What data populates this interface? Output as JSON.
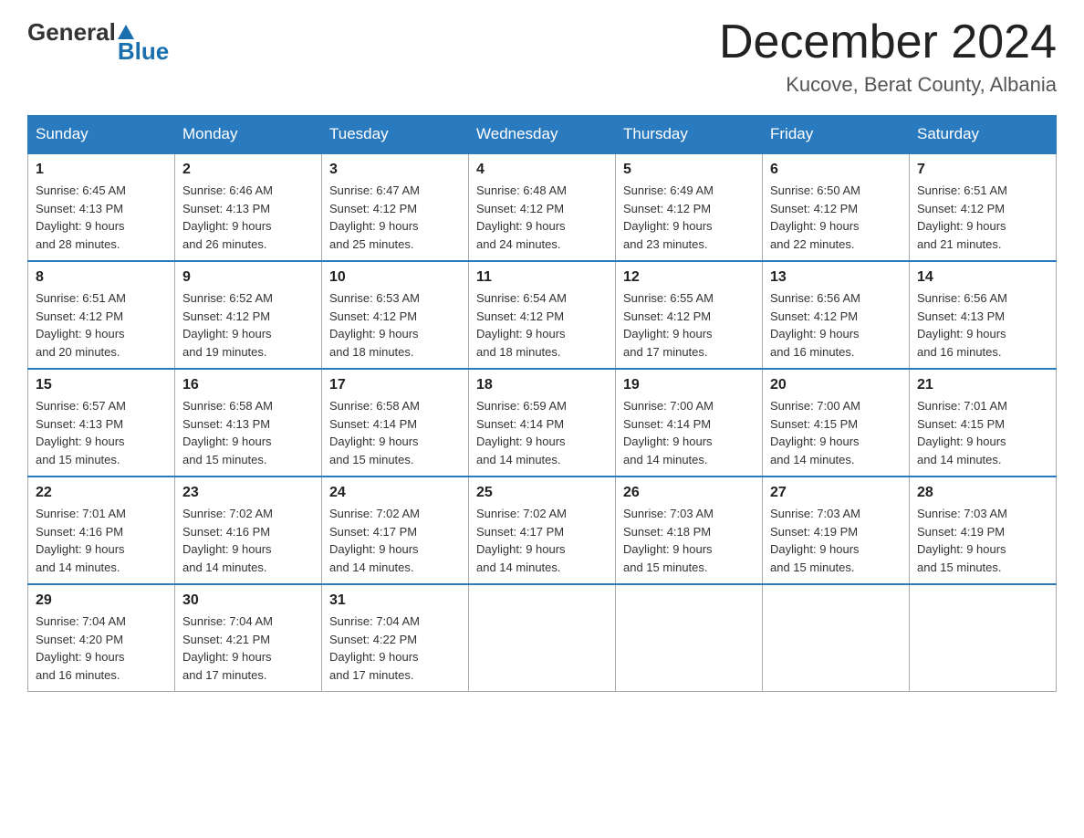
{
  "logo": {
    "general": "General",
    "blue": "Blue"
  },
  "header": {
    "month": "December 2024",
    "location": "Kucove, Berat County, Albania"
  },
  "days_of_week": [
    "Sunday",
    "Monday",
    "Tuesday",
    "Wednesday",
    "Thursday",
    "Friday",
    "Saturday"
  ],
  "weeks": [
    [
      {
        "day": "1",
        "sunrise": "6:45 AM",
        "sunset": "4:13 PM",
        "daylight": "9 hours and 28 minutes."
      },
      {
        "day": "2",
        "sunrise": "6:46 AM",
        "sunset": "4:13 PM",
        "daylight": "9 hours and 26 minutes."
      },
      {
        "day": "3",
        "sunrise": "6:47 AM",
        "sunset": "4:12 PM",
        "daylight": "9 hours and 25 minutes."
      },
      {
        "day": "4",
        "sunrise": "6:48 AM",
        "sunset": "4:12 PM",
        "daylight": "9 hours and 24 minutes."
      },
      {
        "day": "5",
        "sunrise": "6:49 AM",
        "sunset": "4:12 PM",
        "daylight": "9 hours and 23 minutes."
      },
      {
        "day": "6",
        "sunrise": "6:50 AM",
        "sunset": "4:12 PM",
        "daylight": "9 hours and 22 minutes."
      },
      {
        "day": "7",
        "sunrise": "6:51 AM",
        "sunset": "4:12 PM",
        "daylight": "9 hours and 21 minutes."
      }
    ],
    [
      {
        "day": "8",
        "sunrise": "6:51 AM",
        "sunset": "4:12 PM",
        "daylight": "9 hours and 20 minutes."
      },
      {
        "day": "9",
        "sunrise": "6:52 AM",
        "sunset": "4:12 PM",
        "daylight": "9 hours and 19 minutes."
      },
      {
        "day": "10",
        "sunrise": "6:53 AM",
        "sunset": "4:12 PM",
        "daylight": "9 hours and 18 minutes."
      },
      {
        "day": "11",
        "sunrise": "6:54 AM",
        "sunset": "4:12 PM",
        "daylight": "9 hours and 18 minutes."
      },
      {
        "day": "12",
        "sunrise": "6:55 AM",
        "sunset": "4:12 PM",
        "daylight": "9 hours and 17 minutes."
      },
      {
        "day": "13",
        "sunrise": "6:56 AM",
        "sunset": "4:12 PM",
        "daylight": "9 hours and 16 minutes."
      },
      {
        "day": "14",
        "sunrise": "6:56 AM",
        "sunset": "4:13 PM",
        "daylight": "9 hours and 16 minutes."
      }
    ],
    [
      {
        "day": "15",
        "sunrise": "6:57 AM",
        "sunset": "4:13 PM",
        "daylight": "9 hours and 15 minutes."
      },
      {
        "day": "16",
        "sunrise": "6:58 AM",
        "sunset": "4:13 PM",
        "daylight": "9 hours and 15 minutes."
      },
      {
        "day": "17",
        "sunrise": "6:58 AM",
        "sunset": "4:14 PM",
        "daylight": "9 hours and 15 minutes."
      },
      {
        "day": "18",
        "sunrise": "6:59 AM",
        "sunset": "4:14 PM",
        "daylight": "9 hours and 14 minutes."
      },
      {
        "day": "19",
        "sunrise": "7:00 AM",
        "sunset": "4:14 PM",
        "daylight": "9 hours and 14 minutes."
      },
      {
        "day": "20",
        "sunrise": "7:00 AM",
        "sunset": "4:15 PM",
        "daylight": "9 hours and 14 minutes."
      },
      {
        "day": "21",
        "sunrise": "7:01 AM",
        "sunset": "4:15 PM",
        "daylight": "9 hours and 14 minutes."
      }
    ],
    [
      {
        "day": "22",
        "sunrise": "7:01 AM",
        "sunset": "4:16 PM",
        "daylight": "9 hours and 14 minutes."
      },
      {
        "day": "23",
        "sunrise": "7:02 AM",
        "sunset": "4:16 PM",
        "daylight": "9 hours and 14 minutes."
      },
      {
        "day": "24",
        "sunrise": "7:02 AM",
        "sunset": "4:17 PM",
        "daylight": "9 hours and 14 minutes."
      },
      {
        "day": "25",
        "sunrise": "7:02 AM",
        "sunset": "4:17 PM",
        "daylight": "9 hours and 14 minutes."
      },
      {
        "day": "26",
        "sunrise": "7:03 AM",
        "sunset": "4:18 PM",
        "daylight": "9 hours and 15 minutes."
      },
      {
        "day": "27",
        "sunrise": "7:03 AM",
        "sunset": "4:19 PM",
        "daylight": "9 hours and 15 minutes."
      },
      {
        "day": "28",
        "sunrise": "7:03 AM",
        "sunset": "4:19 PM",
        "daylight": "9 hours and 15 minutes."
      }
    ],
    [
      {
        "day": "29",
        "sunrise": "7:04 AM",
        "sunset": "4:20 PM",
        "daylight": "9 hours and 16 minutes."
      },
      {
        "day": "30",
        "sunrise": "7:04 AM",
        "sunset": "4:21 PM",
        "daylight": "9 hours and 17 minutes."
      },
      {
        "day": "31",
        "sunrise": "7:04 AM",
        "sunset": "4:22 PM",
        "daylight": "9 hours and 17 minutes."
      },
      null,
      null,
      null,
      null
    ]
  ],
  "labels": {
    "sunrise": "Sunrise:",
    "sunset": "Sunset:",
    "daylight": "Daylight:"
  }
}
